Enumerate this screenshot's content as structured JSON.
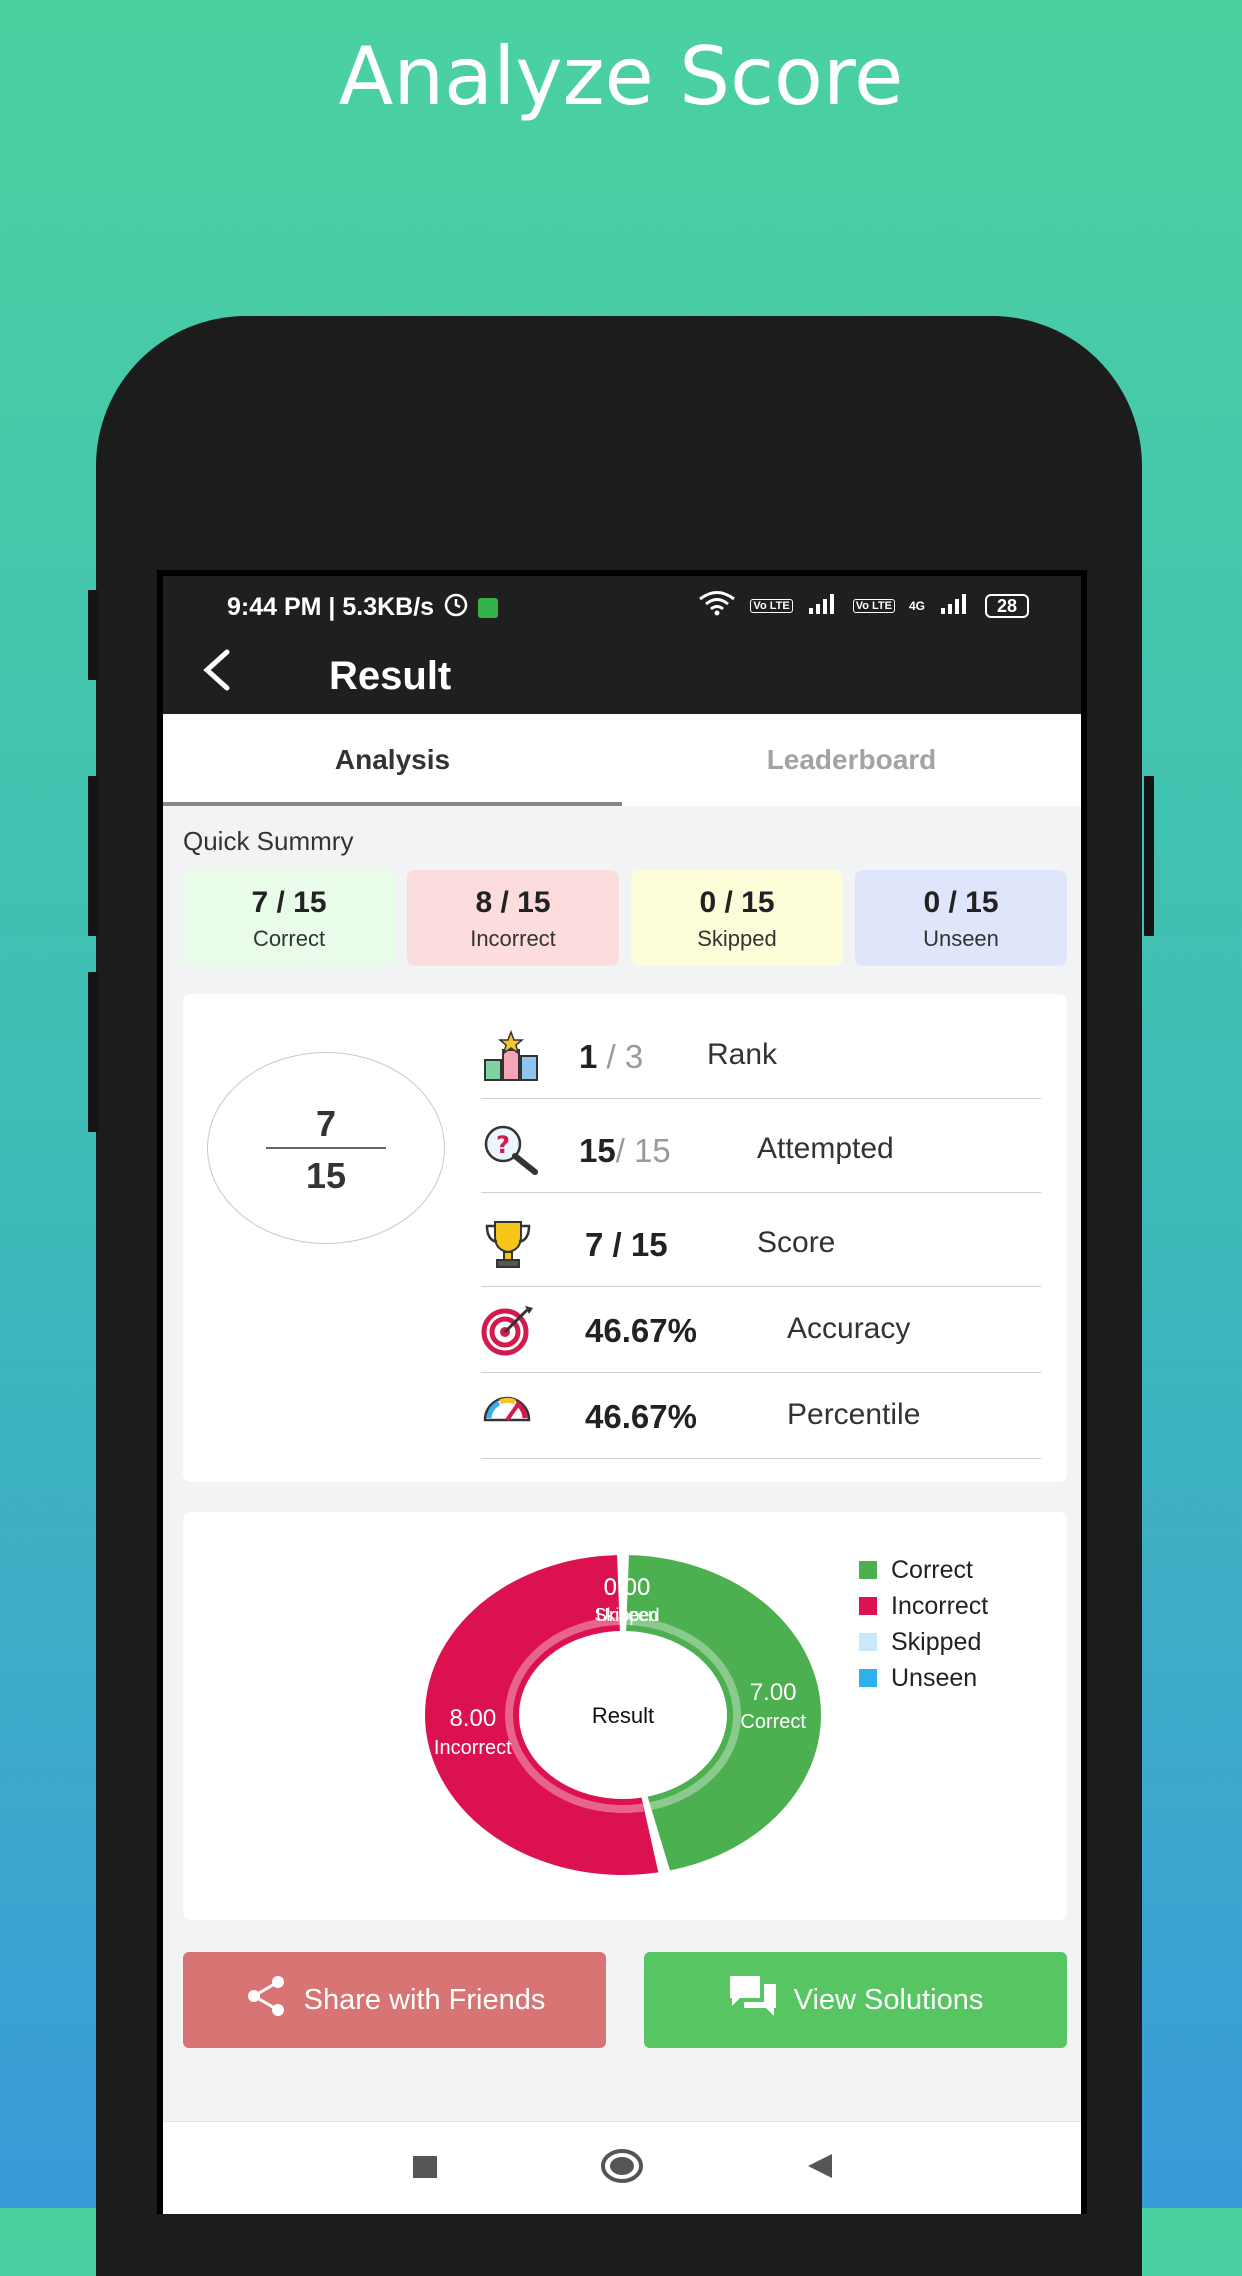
{
  "headline": "Analyze Score",
  "status_bar": {
    "left_text": "9:44 PM | 5.3KB/s",
    "battery": "28",
    "network_tags": [
      "Vo LTE",
      "Vo LTE",
      "4G"
    ]
  },
  "appbar": {
    "title": "Result"
  },
  "tabs": [
    {
      "label": "Analysis",
      "active": true
    },
    {
      "label": "Leaderboard",
      "active": false
    }
  ],
  "summary": {
    "title": "Quick Summry",
    "cards": [
      {
        "value": "7 / 15",
        "label": "Correct",
        "bg": "#e9fbe9"
      },
      {
        "value": "8 / 15",
        "label": "Incorrect",
        "bg": "#fcdcdc"
      },
      {
        "value": "0 / 15",
        "label": "Skipped",
        "bg": "#fdfdd9"
      },
      {
        "value": "0 / 15",
        "label": "Unseen",
        "bg": "#dfe6fb"
      }
    ]
  },
  "score_fraction": {
    "numerator": "7",
    "denominator": "15"
  },
  "stats": [
    {
      "icon": "podium-icon",
      "value": "1",
      "value_dim": " / 3",
      "label": "Rank"
    },
    {
      "icon": "question-magnifier-icon",
      "value": "15",
      "value_dim": "/ 15",
      "label": "Attempted"
    },
    {
      "icon": "trophy-icon",
      "value": "7 / 15",
      "value_dim": "",
      "label": "Score"
    },
    {
      "icon": "target-icon",
      "value": "46.67%",
      "value_dim": "",
      "label": "Accuracy"
    },
    {
      "icon": "gauge-icon",
      "value": "46.67%",
      "value_dim": "",
      "label": "Percentile"
    }
  ],
  "chart_data": {
    "type": "pie",
    "center_label": "Result",
    "categories": [
      "Correct",
      "Incorrect",
      "Skipped",
      "Unseen"
    ],
    "values": [
      7,
      8,
      0,
      0
    ],
    "value_labels": [
      "7.00",
      "8.00",
      "0.00",
      "0.00"
    ],
    "colors": [
      "#4caf50",
      "#dc1250",
      "#c6e9fb",
      "#2fb1ef"
    ],
    "legend_placement": "right"
  },
  "buttons": {
    "share": "Share with Friends",
    "solutions": "View Solutions"
  }
}
